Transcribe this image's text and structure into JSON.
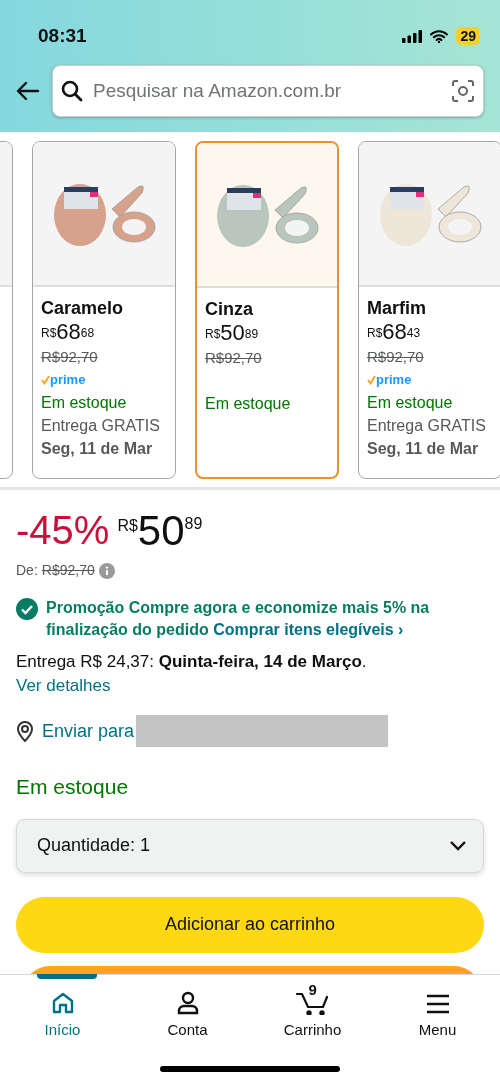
{
  "status_bar": {
    "time": "08:31",
    "battery": "29"
  },
  "search": {
    "placeholder": "Pesquisar na Amazon.com.br"
  },
  "variants": [
    {
      "name": "Caramelo",
      "color": "#d7a28c",
      "currency": "R$",
      "whole": "68",
      "cents": "68",
      "list_price": "R$92,70",
      "prime": true,
      "prime_label": "prime",
      "stock": "Em estoque",
      "shipping": "Entrega GRATIS",
      "date": "Seg, 11 de Mar",
      "selected": false
    },
    {
      "name": "Cinza",
      "color": "#b9c6bd",
      "currency": "R$",
      "whole": "50",
      "cents": "89",
      "list_price": "R$92,70",
      "prime": false,
      "stock": "Em estoque",
      "selected": true
    },
    {
      "name": "Marfim",
      "color": "#efe6da",
      "currency": "R$",
      "whole": "68",
      "cents": "43",
      "list_price": "R$92,70",
      "prime": true,
      "prime_label": "prime",
      "stock": "Em estoque",
      "shipping": "Entrega GRATIS",
      "date": "Seg, 11 de Mar",
      "selected": false
    }
  ],
  "price": {
    "discount": "-45%",
    "currency": "R$",
    "whole": "50",
    "cents": "89",
    "list_label": "De:",
    "list_price": "R$92,70"
  },
  "promo": {
    "text": "Promoção Compre agora e economize mais 5% na finalização do pedido",
    "link": "Comprar itens elegíveis ›"
  },
  "delivery": {
    "text": "Entrega R$ 24,37: **Quinta-feira, 14 de Março**.",
    "link": "Ver detalhes"
  },
  "ship_to": {
    "label": "Enviar para"
  },
  "stock": "Em estoque",
  "quantity": {
    "label": "Quantidade:",
    "value": "1"
  },
  "add_to_cart": "Adicionar ao carrinho",
  "nav": [
    {
      "kind": "home",
      "label": "Início",
      "selected": true
    },
    {
      "kind": "account",
      "label": "Conta",
      "selected": false
    },
    {
      "kind": "cart",
      "label": "Carrinho",
      "badge": "9",
      "selected": false
    },
    {
      "kind": "menu",
      "label": "Menu",
      "selected": false
    }
  ]
}
